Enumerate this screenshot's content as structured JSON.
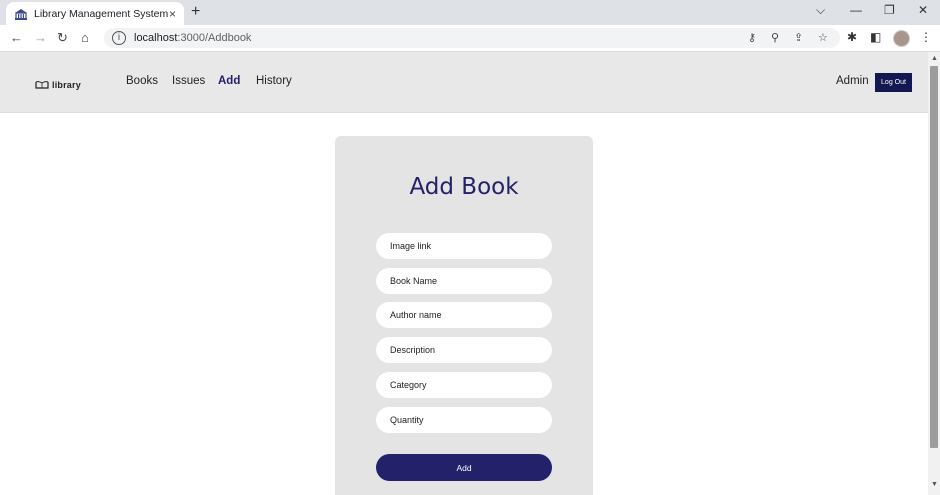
{
  "browser": {
    "tab_title": "Library Management System",
    "tab_close_icon": "×",
    "new_tab_icon": "+",
    "url_host": "localhost",
    "url_path": ":3000/Addbook",
    "window_controls": {
      "dropdown": "⌵",
      "minimize": "—",
      "restore": "❐",
      "close": "✕"
    },
    "nav_icons": {
      "back": "←",
      "forward": "→",
      "reload": "↻",
      "home": "⌂"
    },
    "toolbar_icons": {
      "key": "⚷",
      "zoom": "⚲",
      "share": "⇪",
      "bookmark": "☆",
      "extensions": "✱",
      "sidebar": "◧",
      "menu": "⋮"
    }
  },
  "navbar": {
    "logo_text": "library",
    "links": [
      "Books",
      "Issues",
      "Add",
      "History"
    ],
    "active_link": "Add",
    "user_label": "Admin",
    "logout_label": "Log Out"
  },
  "form": {
    "title": "Add Book",
    "fields": {
      "image_link": "Image link",
      "book_name": "Book Name",
      "author_name": "Author name",
      "description": "Description",
      "category": "Category",
      "quantity": "Quantity"
    },
    "submit_label": "Add"
  },
  "colors": {
    "accent": "#23216a",
    "logout_bg": "#141852",
    "navbar_bg": "#e8e8e8",
    "card_bg": "#e4e4e4"
  }
}
